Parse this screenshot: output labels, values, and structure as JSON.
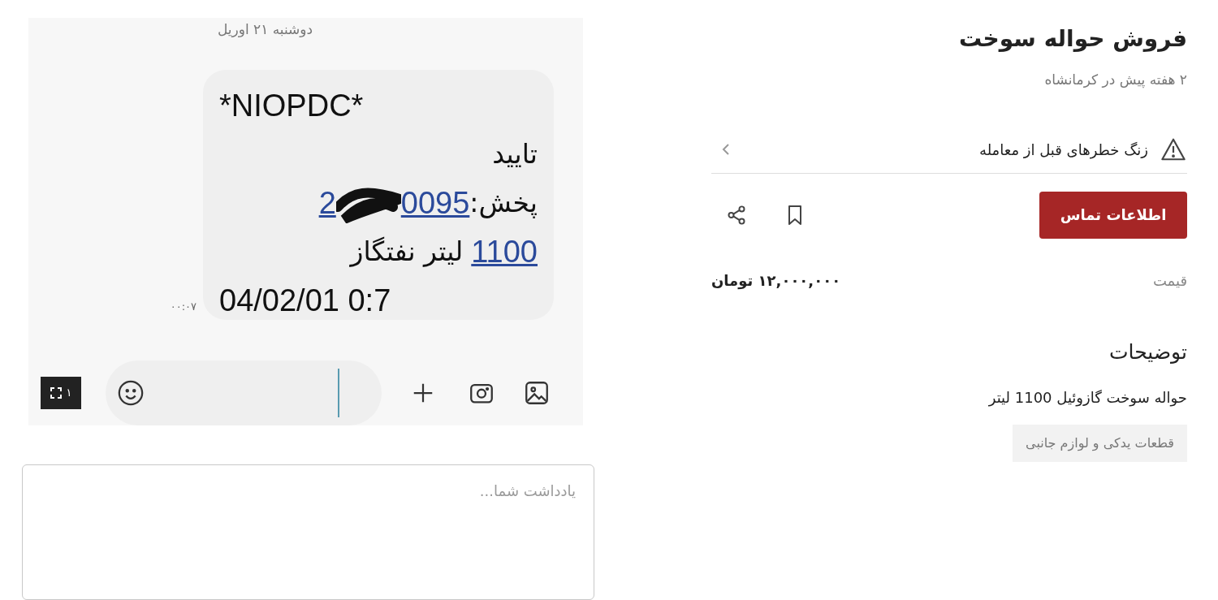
{
  "sms_screenshot": {
    "date_header": "دوشنبه ۲۱ اوریل",
    "message": {
      "sender": "*NIOPDC*",
      "status": "تایید",
      "dispatch_label": "پخش:",
      "dispatch_number_start": "2",
      "dispatch_number_end": "0095",
      "amount_link": "1100",
      "amount_text": "لیتر نفتگاز",
      "datetime": "04/02/01 0:7"
    },
    "time": "۰۰:۰۷",
    "image_badge": "۱"
  },
  "note_field": {
    "placeholder": "یادداشت شما..."
  },
  "ad": {
    "title": "فروش حواله سوخت",
    "posted": "۲ هفته پیش در کرمانشاه",
    "warning": "زنگ خطرهای قبل از معامله",
    "contact_button": "اطلاعات تماس",
    "price_label": "قیمت",
    "price_value": "۱۲,۰۰۰,۰۰۰ تومان",
    "description_heading": "توضیحات",
    "description": "حواله سوخت گازوئیل 1100 لیتر",
    "tags": [
      "قطعات یدکی و لوازم جانبی"
    ]
  }
}
